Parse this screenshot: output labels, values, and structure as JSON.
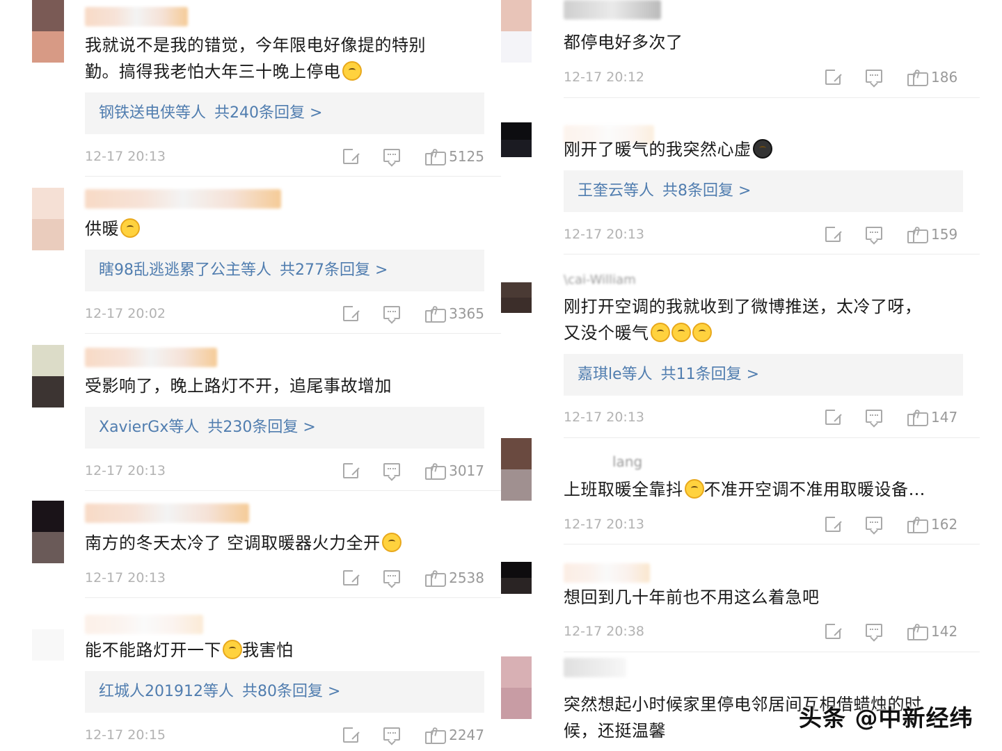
{
  "left_column": [
    {
      "text": "我就说不是我的错觉，今年限电好像提的特别勤。搞得我老怕大年三十晚上停电",
      "text_line1": "我就说不是我的错觉，今年限电好像提的特别",
      "text_line2": "勤。搞得我老怕大年三十晚上停电",
      "emojis": [
        "thinking-emoji"
      ],
      "reply_users": "钢铁送电侠等人",
      "reply_count": "共240条回复 >",
      "time": "12-17 20:13",
      "likes": "5125",
      "avatar_colors": [
        "#7a5a55",
        "#d79a85"
      ]
    },
    {
      "text_line1": "供暖",
      "emojis": [
        "glasses-emoji"
      ],
      "reply_users": "瞎98乱逃逃累了公主等人",
      "reply_count": "共277条回复 >",
      "time": "12-17 20:02",
      "likes": "3365",
      "avatar_colors": [
        "#f5e0d5",
        "#eaccbd"
      ]
    },
    {
      "text_line1": "受影响了，晚上路灯不开，追尾事故增加",
      "reply_users": "XavierGx等人",
      "reply_count": "共230条回复 >",
      "time": "12-17 20:13",
      "likes": "3017",
      "avatar_colors": [
        "#dcdcc8",
        "#3c3432"
      ]
    },
    {
      "text_line1": "南方的冬天太冷了 空调取暖器火力全开",
      "emojis": [
        "crying-laugh-emoji"
      ],
      "time": "12-17 20:13",
      "likes": "2538",
      "avatar_colors": [
        "#1a1318",
        "#6a5a58"
      ]
    },
    {
      "text_line1": "能不能路灯开一下",
      "text_line1b": "我害怕",
      "emojis": [
        "crying-emoji"
      ],
      "reply_users": "红城人201912等人",
      "reply_count": "共80条回复 >",
      "time": "12-17 20:15",
      "likes": "2247",
      "avatar_colors": [
        "#ffffff",
        "#f8f8f8"
      ]
    }
  ],
  "right_column": [
    {
      "text_line1": "都停电好多次了",
      "time": "12-17 20:12",
      "likes": "186",
      "avatar_colors": [
        "#e8c4b8",
        "#f4f4f8"
      ]
    },
    {
      "text_line1": "刚开了暖气的我突然心虚",
      "emojis": [
        "nervous-emoji"
      ],
      "reply_users": "王奎云等人",
      "reply_count": "共8条回复 >",
      "time": "12-17 20:13",
      "likes": "159",
      "avatar_colors": [
        "#0d0d10",
        "#1b1b22"
      ]
    },
    {
      "username_fragment": "\\cai-William",
      "text_line1": "刚打开空调的我就收到了微博推送，太冷了呀，",
      "text_line2": "又没个暖气",
      "emojis": [
        "crying-laugh-emoji",
        "crying-laugh-emoji",
        "crying-laugh-emoji"
      ],
      "reply_users": "嘉琪le等人",
      "reply_count": "共11条回复 >",
      "time": "12-17 20:13",
      "likes": "147",
      "avatar_colors": [
        "#4a3a34",
        "#3c2e2a"
      ]
    },
    {
      "username_fragment": "lang",
      "text_line1": "上班取暖全靠抖",
      "text_line1b": "不准开空调不准用取暖设备…",
      "emojis": [
        "tongue-emoji"
      ],
      "time": "12-17 20:13",
      "likes": "162",
      "avatar_colors": [
        "#6a4a40",
        "#a09090"
      ]
    },
    {
      "text_line1": "想回到几十年前也不用这么着急吧",
      "time": "12-17 20:38",
      "likes": "142",
      "avatar_colors": [
        "#0e0c0e",
        "#2a2424"
      ]
    },
    {
      "text_line1": "突然想起小时候家里停电邻居间互相借蜡烛的时",
      "text_line2": "候，还挺温馨",
      "avatar_colors": [
        "#d8b0b4",
        "#c89ca4"
      ]
    }
  ],
  "watermark": "头条 @中新经纬"
}
